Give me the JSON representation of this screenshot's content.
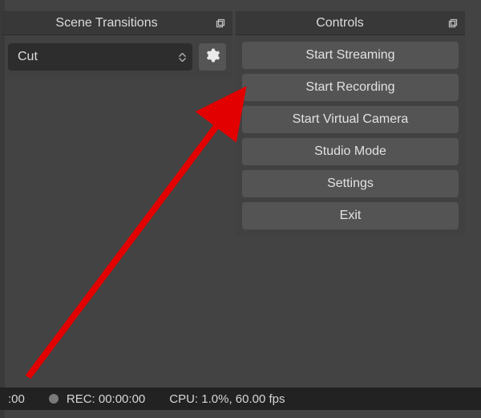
{
  "scene_transitions": {
    "title": "Scene Transitions",
    "selected": "Cut"
  },
  "controls": {
    "title": "Controls",
    "buttons": {
      "start_streaming": "Start Streaming",
      "start_recording": "Start Recording",
      "start_virtual_camera": "Start Virtual Camera",
      "studio_mode": "Studio Mode",
      "settings": "Settings",
      "exit": "Exit"
    }
  },
  "status": {
    "live_time": ":00",
    "rec_time": "REC: 00:00:00",
    "cpu": "CPU: 1.0%, 60.00 fps"
  }
}
